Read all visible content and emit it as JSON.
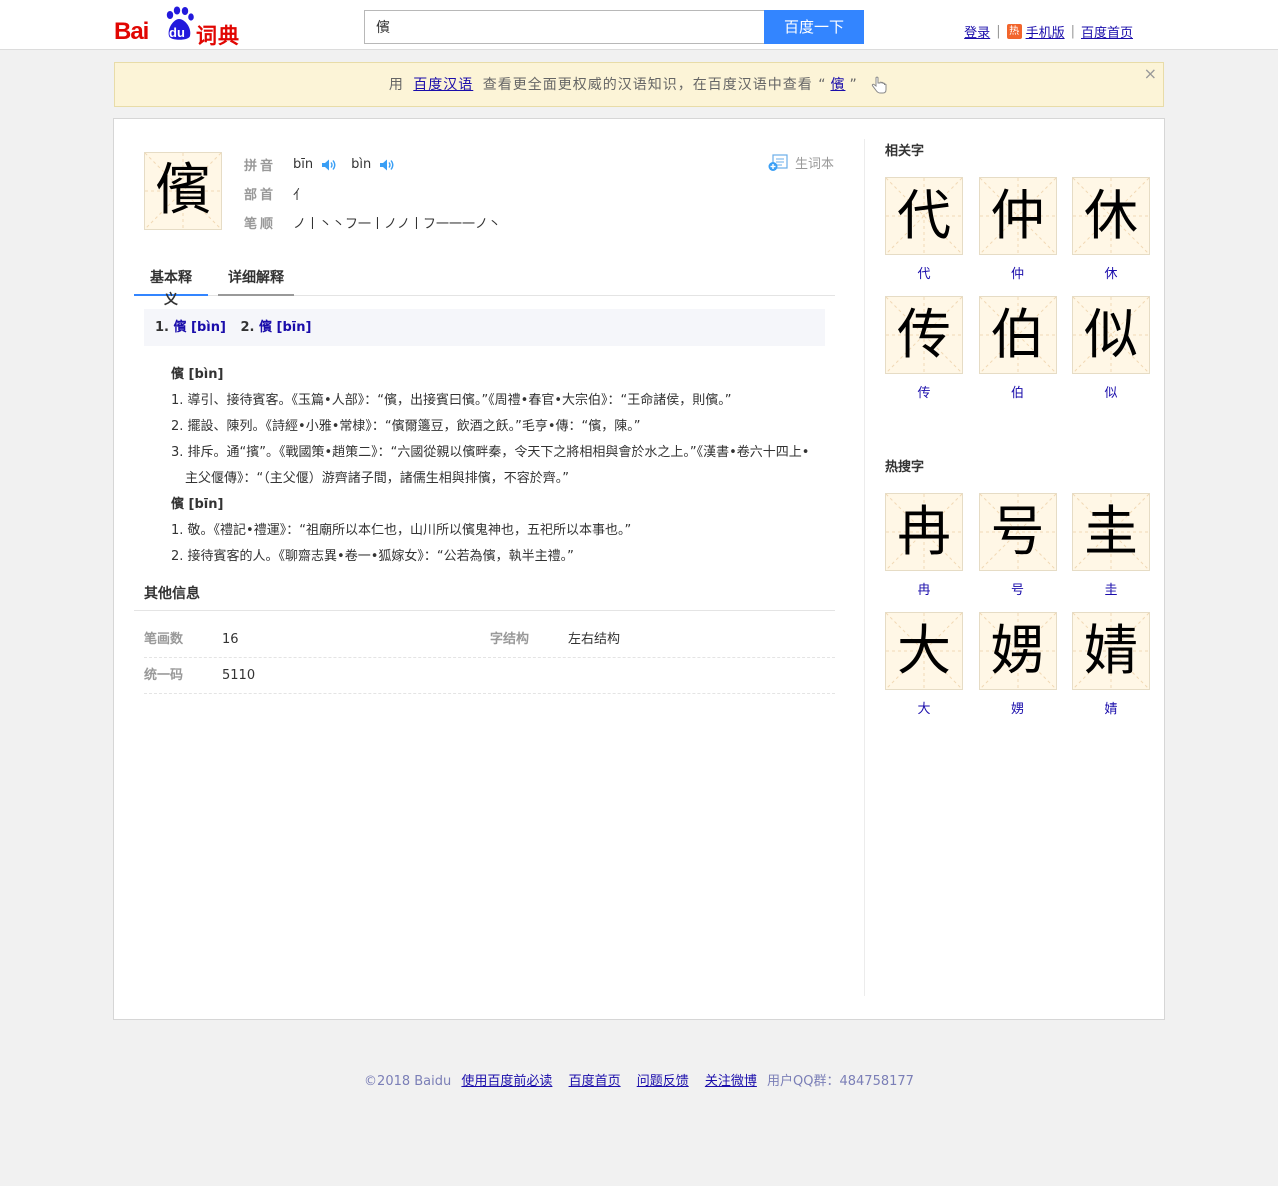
{
  "header": {
    "logo_bai": "Bai",
    "logo_du": "du",
    "logo_cidian": "词典",
    "search_value": "儐",
    "search_button": "百度一下",
    "login": "登录",
    "hot_badge": "热",
    "mobile": "手机版",
    "home": "百度首页"
  },
  "notice": {
    "prefix": "用",
    "link1": "百度汉语",
    "middle": "查看更全面更权威的汉语知识，在百度汉语中查看",
    "quote_open": "“",
    "link2": "儐",
    "quote_close": "”",
    "close": "×"
  },
  "entry": {
    "char": "儐",
    "pinyin_label": "拼音",
    "pinyin": [
      "bīn",
      "bìn"
    ],
    "radical_label": "部首",
    "radical": "亻",
    "stroke_label": "笔顺",
    "strokes": "ノ丨丶丶フ一丨ノノ丨フ一一一ノ丶",
    "vocab_button": "生词本"
  },
  "tabs": {
    "basic": "基本释义",
    "detail": "详细解释"
  },
  "subtabs": [
    {
      "num": "1.",
      "label": "儐 [bìn]"
    },
    {
      "num": "2.",
      "label": "儐 [bīn]"
    }
  ],
  "definitions": {
    "head1": "儐 [bìn]",
    "d1_1": "1. 導引、接待賓客。《玉篇•人部》：“儐，出接賓曰儐。”《周禮•春官•大宗伯》：“王命諸侯，則儐。”",
    "d1_2": "2. 擺設、陳列。《詩經•小雅•常棣》：“儐爾籩豆，飲酒之飫。”毛亨•傳：“儐，陳。”",
    "d1_3a": "3. 排斥。通“擯”。《戰國策•趙策二》：“六國從親以儐畔秦，令天下之將相相與會於水之上。”《漢書•卷六十四上•",
    "d1_3b": "主父偃傳》：“（主父偃）游齊諸子間，諸儒生相與排儐，不容於齊。”",
    "head2": "儐 [bīn]",
    "d2_1": "1. 敬。《禮記•禮運》：“祖廟所以本仁也，山川所以儐鬼神也，五祀所以本事也。”",
    "d2_2": "2. 接待賓客的人。《聊齋志異•卷一•狐嫁女》：“公若為儐，執半主禮。”"
  },
  "other": {
    "title": "其他信息",
    "stroke_count_label": "笔画数",
    "stroke_count": "16",
    "structure_label": "字结构",
    "structure": "左右结构",
    "unicode_label": "统一码",
    "unicode": "5110"
  },
  "sidebar": {
    "related_title": "相关字",
    "related": [
      "代",
      "仲",
      "休",
      "传",
      "伯",
      "似"
    ],
    "hot_title": "热搜字",
    "hot": [
      "冉",
      "号",
      "圭",
      "大",
      "娚",
      "婧"
    ]
  },
  "footer": {
    "copyright": "©2018 Baidu",
    "link1": "使用百度前必读",
    "link2": "百度首页",
    "link3": "问题反馈",
    "link4": "关注微博",
    "qq": "用户QQ群：484758177"
  }
}
